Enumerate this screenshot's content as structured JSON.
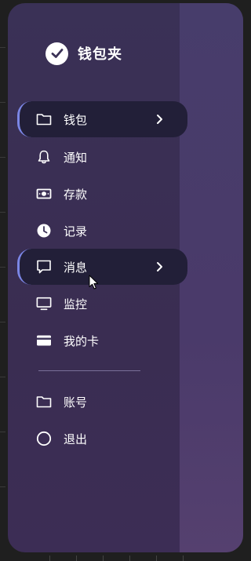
{
  "brand": {
    "title": "钱包夹",
    "icon": "check-circle-icon"
  },
  "menu": {
    "items": [
      {
        "label": "钱包",
        "icon": "folder-icon",
        "active": true,
        "has_submenu": true
      },
      {
        "label": "通知",
        "icon": "bell-icon",
        "active": false
      },
      {
        "label": "存款",
        "icon": "cash-icon",
        "active": false
      },
      {
        "label": "记录",
        "icon": "clock-icon",
        "active": false
      },
      {
        "label": "消息",
        "icon": "chat-icon",
        "active": true,
        "has_submenu": true
      },
      {
        "label": "监控",
        "icon": "monitor-icon",
        "active": false
      },
      {
        "label": "我的卡",
        "icon": "card-icon",
        "active": false
      }
    ],
    "secondary_items": [
      {
        "label": "账号",
        "icon": "folder-icon"
      },
      {
        "label": "退出",
        "icon": "circle-icon"
      }
    ]
  },
  "colors": {
    "panel": "#3a3156",
    "active_bg": "#221f38",
    "active_accent": "#7b86e6",
    "text": "#ffffff"
  }
}
